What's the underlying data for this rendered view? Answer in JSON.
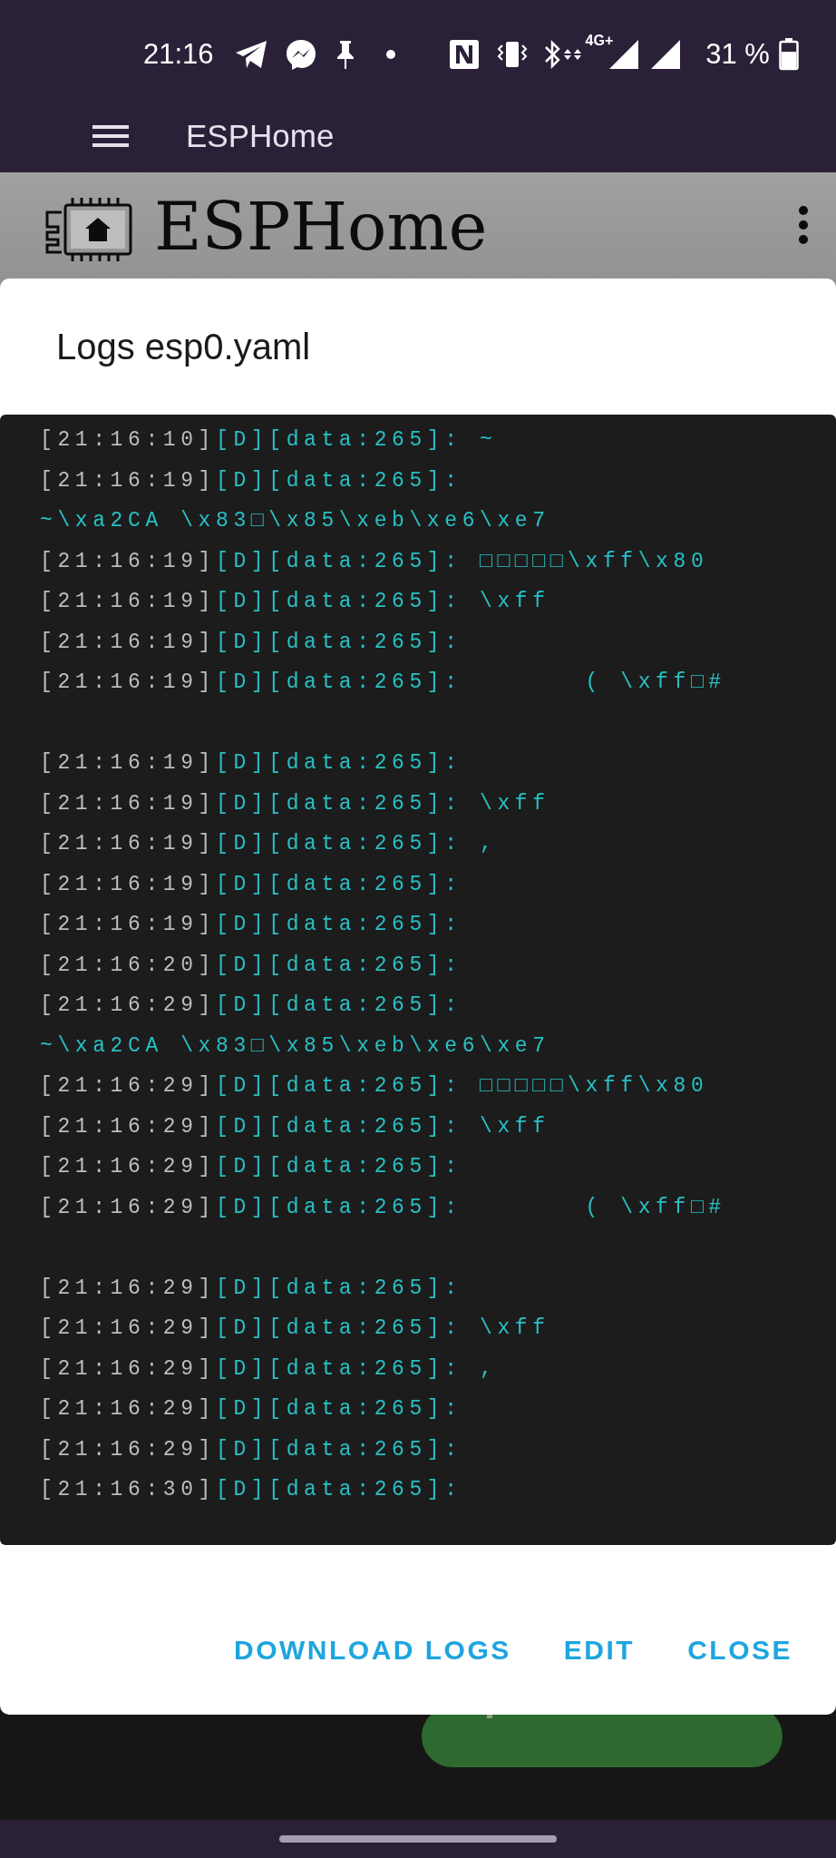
{
  "status_bar": {
    "time": "21:16",
    "network": "4G+",
    "battery": "31 %"
  },
  "app_bar": {
    "title": "ESPHome"
  },
  "page_header": {
    "title": "ESPHome"
  },
  "dialog": {
    "title": "Logs esp0.yaml",
    "log_lines": [
      {
        "kind": "entry",
        "time": "[21:16:10]",
        "level": "[D]",
        "tag": "[data:265]:",
        "message": "~"
      },
      {
        "kind": "entry",
        "time": "[21:16:19]",
        "level": "[D]",
        "tag": "[data:265]:"
      },
      {
        "kind": "continuation",
        "message": "~\\xa2CA \\x83□\\x85\\xeb\\xe6\\xe7"
      },
      {
        "kind": "entry",
        "time": "[21:16:19]",
        "level": "[D]",
        "tag": "[data:265]:",
        "message": "□□□□□\\xff\\x80"
      },
      {
        "kind": "entry",
        "time": "[21:16:19]",
        "level": "[D]",
        "tag": "[data:265]:",
        "message": "\\xff"
      },
      {
        "kind": "entry",
        "time": "[21:16:19]",
        "level": "[D]",
        "tag": "[data:265]:"
      },
      {
        "kind": "entry",
        "time": "[21:16:19]",
        "level": "[D]",
        "tag": "[data:265]:",
        "message": "      ( \\xff□#"
      },
      {
        "kind": "blank"
      },
      {
        "kind": "entry",
        "time": "[21:16:19]",
        "level": "[D]",
        "tag": "[data:265]:"
      },
      {
        "kind": "entry",
        "time": "[21:16:19]",
        "level": "[D]",
        "tag": "[data:265]:",
        "message": "\\xff"
      },
      {
        "kind": "entry",
        "time": "[21:16:19]",
        "level": "[D]",
        "tag": "[data:265]:",
        "message": ","
      },
      {
        "kind": "entry",
        "time": "[21:16:19]",
        "level": "[D]",
        "tag": "[data:265]:"
      },
      {
        "kind": "entry",
        "time": "[21:16:19]",
        "level": "[D]",
        "tag": "[data:265]:"
      },
      {
        "kind": "entry",
        "time": "[21:16:20]",
        "level": "[D]",
        "tag": "[data:265]:"
      },
      {
        "kind": "entry",
        "time": "[21:16:29]",
        "level": "[D]",
        "tag": "[data:265]:"
      },
      {
        "kind": "continuation",
        "message": "~\\xa2CA \\x83□\\x85\\xeb\\xe6\\xe7"
      },
      {
        "kind": "entry",
        "time": "[21:16:29]",
        "level": "[D]",
        "tag": "[data:265]:",
        "message": "□□□□□\\xff\\x80"
      },
      {
        "kind": "entry",
        "time": "[21:16:29]",
        "level": "[D]",
        "tag": "[data:265]:",
        "message": "\\xff"
      },
      {
        "kind": "entry",
        "time": "[21:16:29]",
        "level": "[D]",
        "tag": "[data:265]:"
      },
      {
        "kind": "entry",
        "time": "[21:16:29]",
        "level": "[D]",
        "tag": "[data:265]:",
        "message": "      ( \\xff□#"
      },
      {
        "kind": "blank"
      },
      {
        "kind": "entry",
        "time": "[21:16:29]",
        "level": "[D]",
        "tag": "[data:265]:"
      },
      {
        "kind": "entry",
        "time": "[21:16:29]",
        "level": "[D]",
        "tag": "[data:265]:",
        "message": "\\xff"
      },
      {
        "kind": "entry",
        "time": "[21:16:29]",
        "level": "[D]",
        "tag": "[data:265]:",
        "message": ","
      },
      {
        "kind": "entry",
        "time": "[21:16:29]",
        "level": "[D]",
        "tag": "[data:265]:"
      },
      {
        "kind": "entry",
        "time": "[21:16:29]",
        "level": "[D]",
        "tag": "[data:265]:"
      },
      {
        "kind": "entry",
        "time": "[21:16:30]",
        "level": "[D]",
        "tag": "[data:265]:"
      }
    ],
    "buttons": [
      "DOWNLOAD LOGS",
      "EDIT",
      "CLOSE"
    ]
  }
}
